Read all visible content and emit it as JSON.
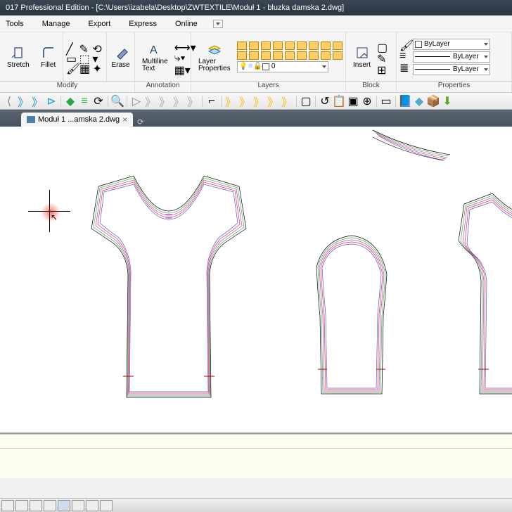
{
  "title": "017 Professional Edition - [C:\\Users\\izabela\\Desktop\\ZWTEXTILE\\Moduł 1 - bluzka damska 2.dwg]",
  "menus": {
    "tools": "Tools",
    "manage": "Manage",
    "export": "Export",
    "express": "Express",
    "online": "Online"
  },
  "ribbon": {
    "stretch": "Stretch",
    "fillet": "Fillet",
    "erase": "Erase",
    "multiline_text": "Multiline\nText",
    "layer_properties": "Layer\nProperties",
    "insert": "Insert"
  },
  "panels": {
    "modify": "Modify",
    "annotation": "Annotation",
    "layers": "Layers",
    "block": "Block",
    "properties": "Properties"
  },
  "tab": {
    "name": "Moduł 1 ...amska 2.dwg"
  },
  "props": {
    "bylayer1": "ByLayer",
    "bylayer2": "ByLayer",
    "bylayer3": "ByLayer"
  },
  "layer_current": "0"
}
